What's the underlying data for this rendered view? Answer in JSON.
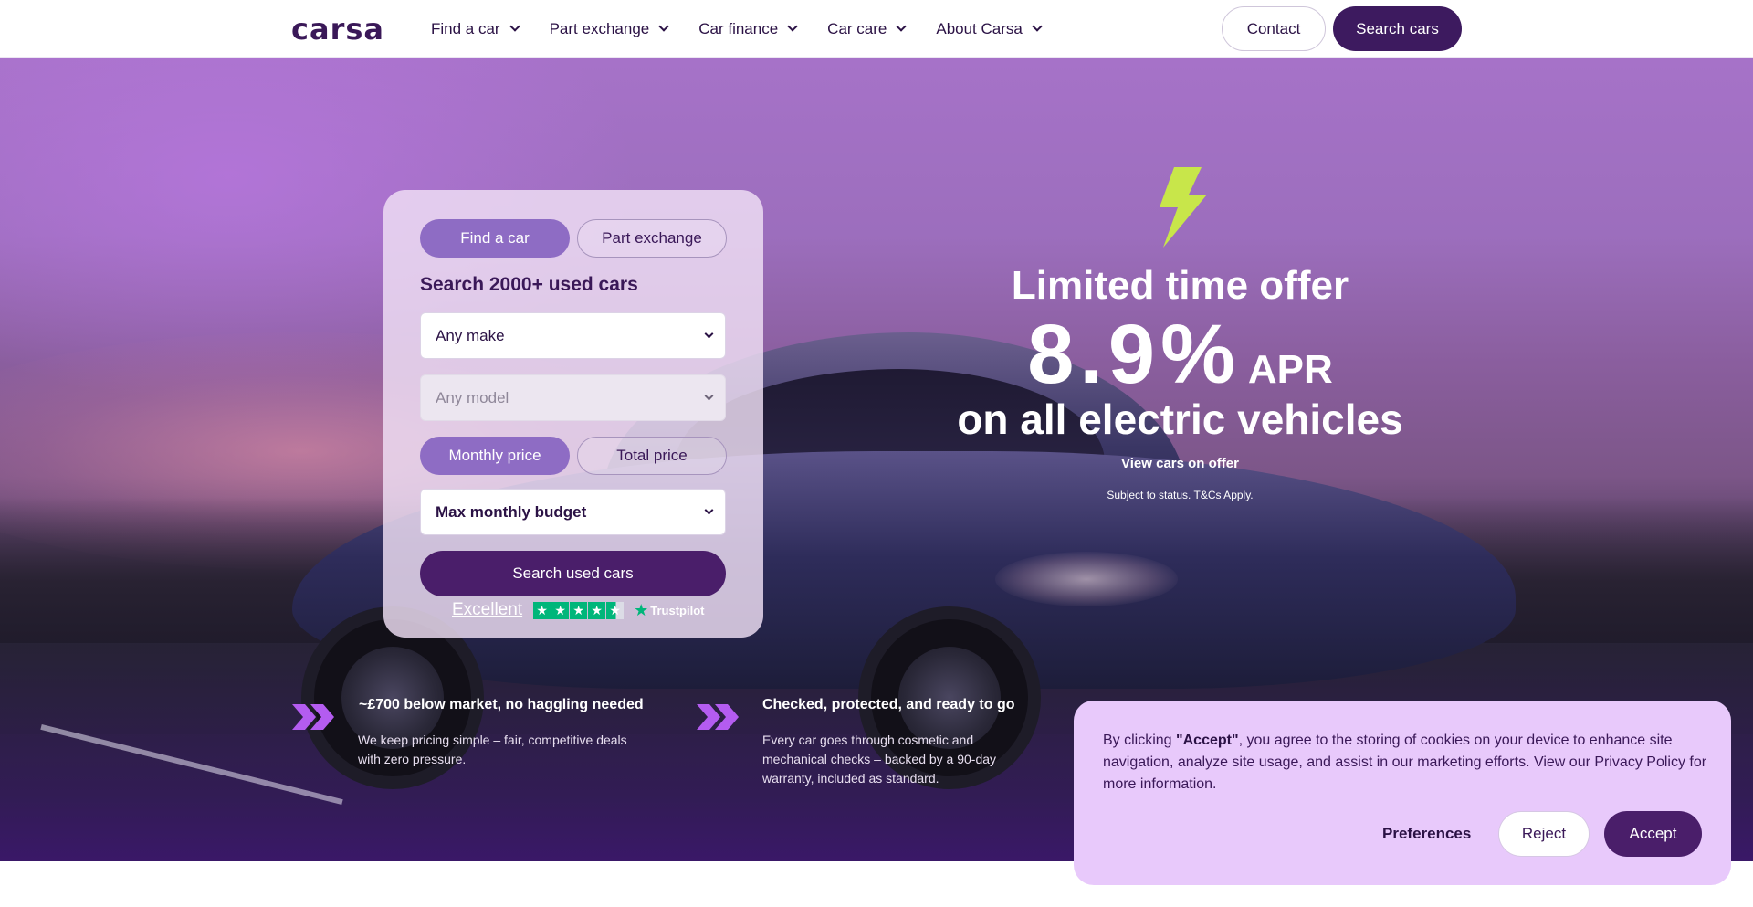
{
  "header": {
    "logo": "carsa",
    "nav": [
      {
        "label": "Find a car"
      },
      {
        "label": "Part exchange"
      },
      {
        "label": "Car finance"
      },
      {
        "label": "Car care"
      },
      {
        "label": "About Carsa"
      }
    ],
    "contact_label": "Contact",
    "search_label": "Search cars"
  },
  "search_card": {
    "tabs": [
      {
        "label": "Find a car",
        "active": true
      },
      {
        "label": "Part exchange",
        "active": false
      }
    ],
    "title": "Search 2000+ used cars",
    "make_select": "Any make",
    "model_select": "Any model",
    "price_toggle": [
      {
        "label": "Monthly price",
        "active": true
      },
      {
        "label": "Total price",
        "active": false
      }
    ],
    "budget_select": "Max monthly budget",
    "submit_label": "Search used cars"
  },
  "trustpilot": {
    "rating_label": "Excellent",
    "stars": 4.5,
    "brand": "Trustpilot"
  },
  "offer": {
    "title": "Limited time offer",
    "rate": "8.9%",
    "rate_suffix": "APR",
    "subtitle": "on all electric vehicles",
    "link": "View cars on offer",
    "terms": "Subject to status. T&Cs Apply."
  },
  "features": [
    {
      "title": "~£700 below market, no haggling needed",
      "desc_lines": [
        "We keep pricing simple – fair, competitive deals",
        "with zero pressure."
      ]
    },
    {
      "title": "Checked, protected, and ready to go",
      "desc_lines": [
        "Every car goes through cosmetic and",
        "mechanical checks – backed by a 90-day",
        "warranty, included as standard."
      ]
    }
  ],
  "cookie": {
    "prefix": "By clicking ",
    "accept_quoted": "\"Accept\"",
    "body": ", you agree to the storing of cookies on your device to enhance site navigation, analyze site usage, and assist in our marketing efforts. View our Privacy Policy for more information.",
    "preferences_label": "Preferences",
    "reject_label": "Reject",
    "accept_label": "Accept"
  },
  "colors": {
    "brand_dark": "#3d1a5f",
    "accent_purple": "#8e6cc4",
    "bolt_green": "#c8e64a",
    "cookie_bg": "#e8c9fb",
    "trustpilot_green": "#00b67a"
  },
  "icons": [
    "chevron-down-icon",
    "lightning-bolt-icon",
    "double-chevron-icon",
    "star-icon"
  ]
}
